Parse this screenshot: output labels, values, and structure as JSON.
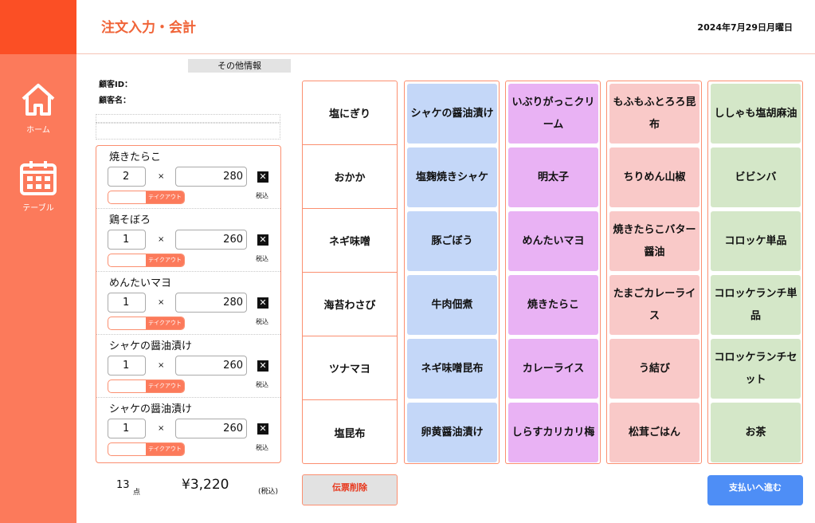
{
  "header": {
    "title": "注文入力・会計",
    "date": "2024年7月29日月曜日"
  },
  "nav": [
    {
      "label": "ホーム",
      "icon": "home-icon"
    },
    {
      "label": "テーブル",
      "icon": "calendar-icon"
    }
  ],
  "customer": {
    "section_label": "その他情報",
    "id_label": "顧客ID：",
    "name_label": "顧客名："
  },
  "order_items": [
    {
      "name": "焼きたらこ",
      "qty": "2",
      "price": "280",
      "takeout": "テイクアウト",
      "tax": "税込"
    },
    {
      "name": "鶏そぼろ",
      "qty": "1",
      "price": "260",
      "takeout": "テイクアウト",
      "tax": "税込"
    },
    {
      "name": "めんたいマヨ",
      "qty": "1",
      "price": "280",
      "takeout": "テイクアウト",
      "tax": "税込"
    },
    {
      "name": "シャケの醤油漬け",
      "qty": "1",
      "price": "260",
      "takeout": "テイクアウト",
      "tax": "税込"
    },
    {
      "name": "シャケの醤油漬け",
      "qty": "1",
      "price": "260",
      "takeout": "テイクアウト",
      "tax": "税込"
    }
  ],
  "summary": {
    "count": "13",
    "count_unit": "点",
    "total": "¥3,220",
    "tax_note": "(税込)"
  },
  "categories": [
    "塩にぎり",
    "おかか",
    "ネギ味噌",
    "海苔わさび",
    "ツナマヨ",
    "塩昆布"
  ],
  "menu_columns": [
    {
      "color": "#c4d7f8",
      "items": [
        "シャケの醤油漬け",
        "塩麹焼きシャケ",
        "豚ごぼう",
        "牛肉佃煮",
        "ネギ味噌昆布",
        "卵黄醤油漬け"
      ]
    },
    {
      "color": "#e9b2f4",
      "items": [
        "いぶりがっこクリーム",
        "明太子",
        "めんたいマヨ",
        "焼きたらこ",
        "カレーライス",
        "しらすカリカリ梅"
      ]
    },
    {
      "color": "#f9c9c8",
      "items": [
        "もふもふとろろ昆布",
        "ちりめん山椒",
        "焼きたらこバター醤油",
        "たまごカレーライス",
        "う結び",
        "松茸ごはん"
      ]
    },
    {
      "color": "#d4e7c8",
      "items": [
        "ししゃも塩胡麻油",
        "ビビンバ",
        "コロッケ単品",
        "コロッケランチ単品",
        "コロッケランチセット",
        "お茶"
      ]
    }
  ],
  "actions": {
    "delete_label": "伝票削除",
    "pay_label": "支払いへ進む"
  }
}
